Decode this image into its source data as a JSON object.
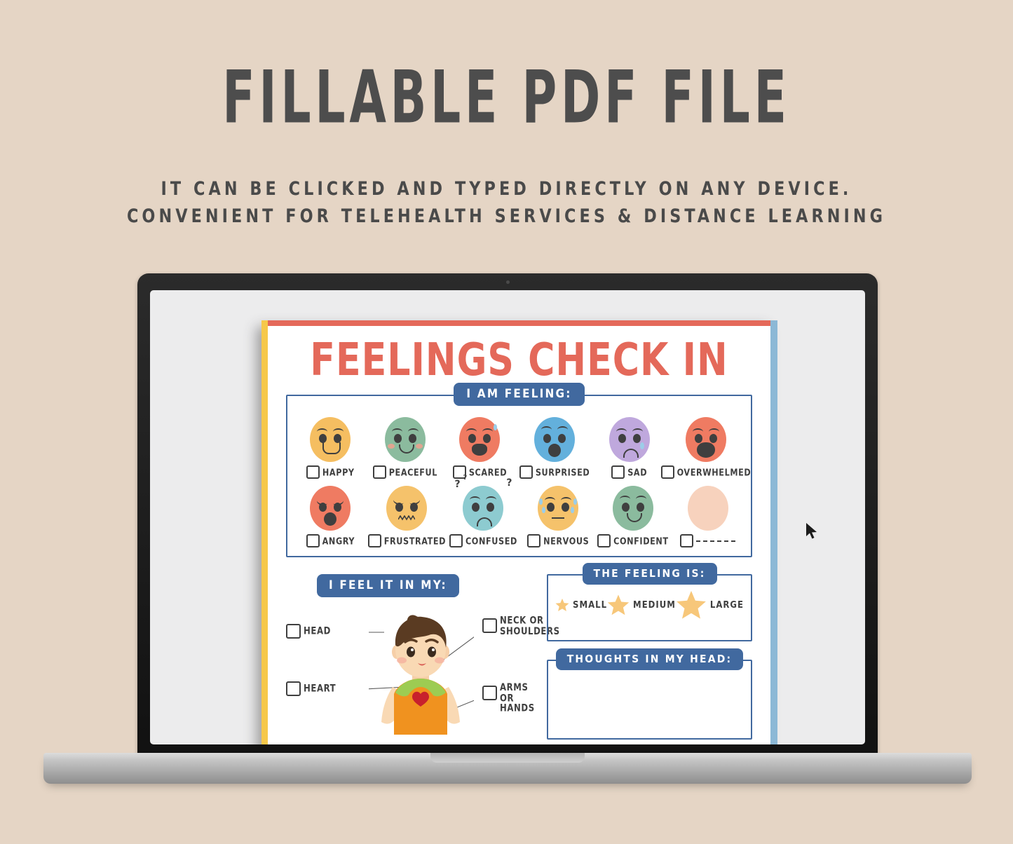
{
  "promo": {
    "title": "FILLABLE PDF FILE",
    "subtitle_line1": "IT CAN BE CLICKED AND TYPED DIRECTLY ON ANY DEVICE.",
    "subtitle_line2": "CONVENIENT FOR TELEHEALTH SERVICES & DISTANCE LEARNING"
  },
  "device": {
    "type": "laptop",
    "cursor_icon": "arrow-cursor"
  },
  "worksheet": {
    "title": "FEELINGS CHECK IN",
    "accent_colors": {
      "title": "#e4695a",
      "badge": "#41699f",
      "edge_left": "#f6c84a",
      "edge_top": "#e4695a",
      "edge_right": "#8cb8d6",
      "star": "#f7c77a",
      "page_background": "#ffffff"
    },
    "feelings_section": {
      "badge": "I AM FEELING:",
      "rows": [
        [
          {
            "label": "HAPPY",
            "color": "#f5be61",
            "face": "happy"
          },
          {
            "label": "PEACEFUL",
            "color": "#8bbb9e",
            "face": "peaceful"
          },
          {
            "label": "SCARED",
            "color": "#ef7b62",
            "face": "scared"
          },
          {
            "label": "SURPRISED",
            "color": "#63b0dc",
            "face": "surprised"
          },
          {
            "label": "SAD",
            "color": "#bfa8dd",
            "face": "sad"
          },
          {
            "label": "OVERWHELMED",
            "color": "#ef7b62",
            "face": "overwhelmed"
          }
        ],
        [
          {
            "label": "ANGRY",
            "color": "#ef7b62",
            "face": "angry"
          },
          {
            "label": "FRUSTRATED",
            "color": "#f5c26b",
            "face": "frustrated"
          },
          {
            "label": "CONFUSED",
            "color": "#8dcbd0",
            "face": "confused"
          },
          {
            "label": "NERVOUS",
            "color": "#f5c26b",
            "face": "nervous"
          },
          {
            "label": "CONFIDENT",
            "color": "#8bbb9e",
            "face": "confident"
          },
          {
            "label": "",
            "color": "#f7d2bd",
            "face": "blank"
          }
        ]
      ]
    },
    "body_section": {
      "badge": "I FEEL IT IN MY:",
      "options": [
        {
          "label": "HEAD",
          "position": "left-top"
        },
        {
          "label": "HEART",
          "position": "left-bottom"
        },
        {
          "label": "NECK OR\nSHOULDERS",
          "position": "right-top"
        },
        {
          "label": "ARMS OR\nHANDS",
          "position": "right-bottom"
        }
      ],
      "illustration": "boy-character"
    },
    "size_section": {
      "badge": "THE FEELING IS:",
      "options": [
        {
          "label": "SMALL",
          "star_size": 20
        },
        {
          "label": "MEDIUM",
          "star_size": 32
        },
        {
          "label": "LARGE",
          "star_size": 44
        }
      ]
    },
    "thoughts_section": {
      "badge": "THOUGHTS IN MY HEAD:",
      "value": ""
    }
  }
}
